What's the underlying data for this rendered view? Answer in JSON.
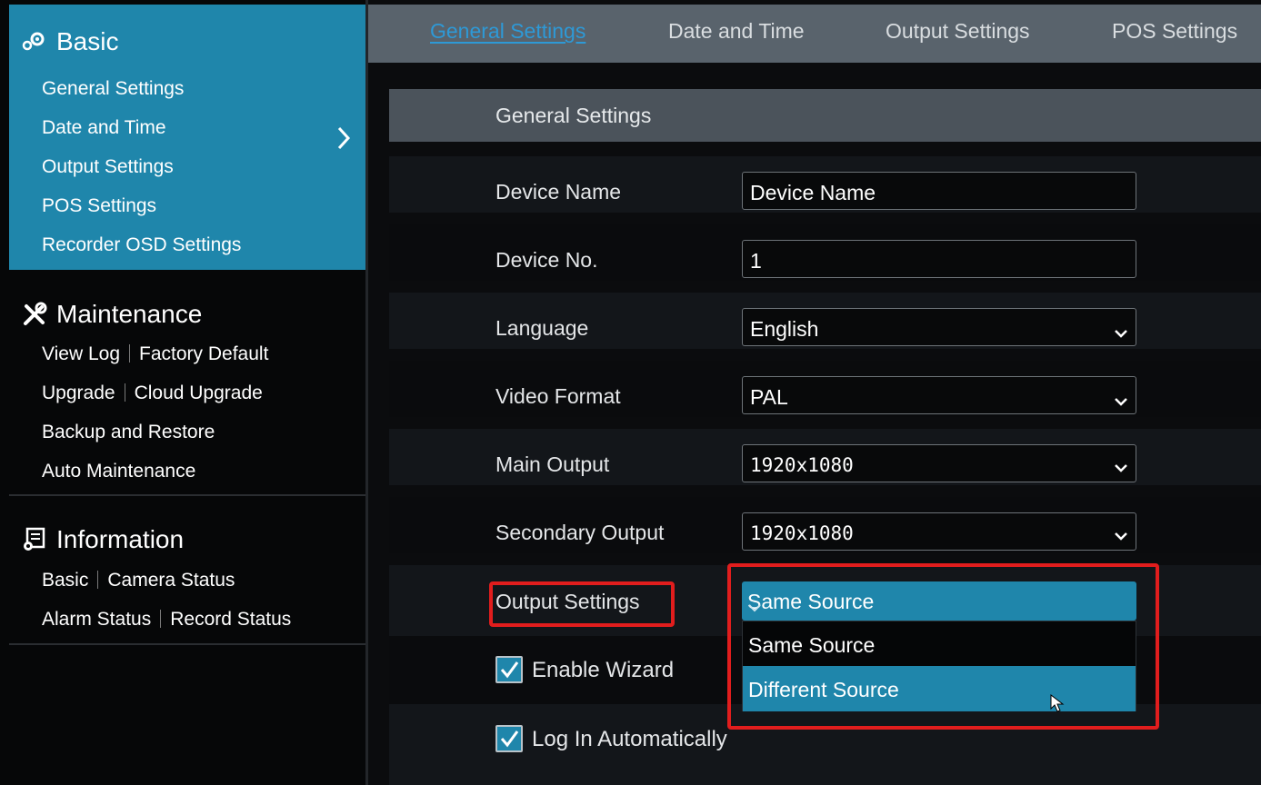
{
  "sidebar": {
    "basic": {
      "title": "Basic",
      "icon": "gears-icon",
      "items": [
        "General Settings",
        "Date and Time",
        "Output Settings",
        "POS Settings",
        "Recorder OSD Settings"
      ]
    },
    "maintenance": {
      "title": "Maintenance",
      "icon": "tools-icon",
      "items": [
        "View Log",
        "Factory Default",
        "Upgrade",
        "Cloud Upgrade",
        "Backup and Restore",
        "Auto Maintenance"
      ]
    },
    "information": {
      "title": "Information",
      "icon": "info-gear-icon",
      "items": [
        "Basic",
        "Camera Status",
        "Alarm Status",
        "Record Status"
      ]
    }
  },
  "tabs": [
    {
      "label": "General Settings",
      "active": true
    },
    {
      "label": "Date and Time",
      "active": false
    },
    {
      "label": "Output Settings",
      "active": false
    },
    {
      "label": "POS Settings",
      "active": false
    }
  ],
  "panel": {
    "title": "General Settings",
    "fields": {
      "device_name": {
        "label": "Device Name",
        "value": "Device Name"
      },
      "device_no": {
        "label": "Device No.",
        "value": "1"
      },
      "language": {
        "label": "Language",
        "value": "English"
      },
      "video_format": {
        "label": "Video Format",
        "value": "PAL"
      },
      "main_output": {
        "label": "Main Output",
        "value": "1920x1080"
      },
      "secondary_output": {
        "label": "Secondary Output",
        "value": "1920x1080"
      },
      "output_settings": {
        "label": "Output Settings",
        "value": "Same Source",
        "options": [
          "Same Source",
          "Different Source"
        ],
        "highlighted": "Different Source"
      }
    },
    "checkboxes": {
      "enable_wizard": {
        "label": "Enable Wizard",
        "checked": true
      },
      "log_in_automatically": {
        "label": "Log In Automatically",
        "checked": true
      }
    }
  },
  "colors": {
    "accent": "#1f86ab",
    "active_tab": "#2e99d6",
    "highlight_box": "#e11d1d"
  }
}
